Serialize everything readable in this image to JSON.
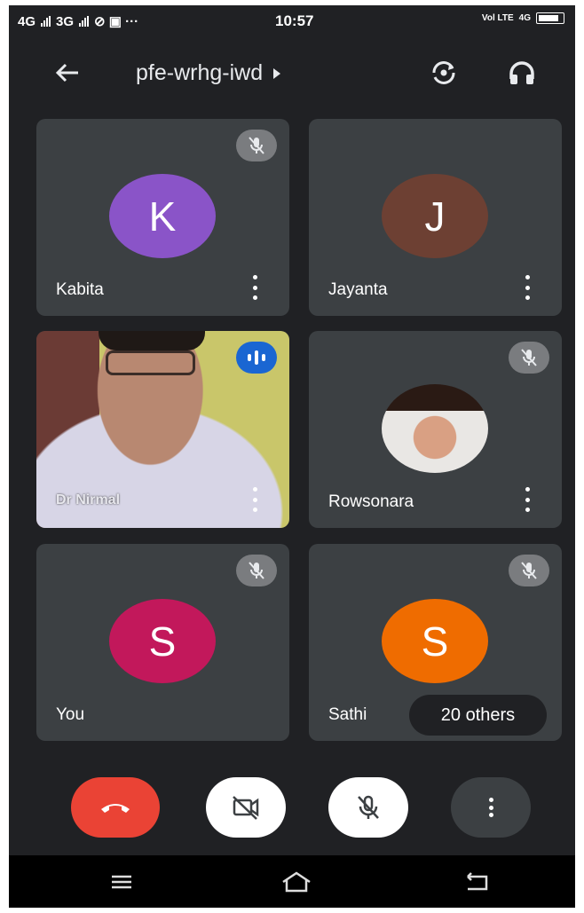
{
  "status_bar": {
    "network1": "4G",
    "network2": "3G",
    "time": "10:57",
    "carrier": "Vol LTE",
    "lte": "4G"
  },
  "app_bar": {
    "meeting_code": "pfe-wrhg-iwd"
  },
  "participants": [
    {
      "name": "Kabita",
      "initial": "K",
      "color": "#8a54c8",
      "muted": true
    },
    {
      "name": "Jayanta",
      "initial": "J",
      "color": "#6d4033",
      "muted": false
    },
    {
      "name": "Dr Nirmal",
      "speaking": true,
      "video": true
    },
    {
      "name": "Rowsonara",
      "photo": true,
      "muted": true
    },
    {
      "name": "You",
      "initial": "S",
      "color": "#c2185b",
      "muted": true
    },
    {
      "name": "Sathi",
      "initial": "S",
      "color": "#ef6c00",
      "muted": true
    }
  ],
  "others_chip": "20 others",
  "controls": {
    "icons": [
      "end-call-icon",
      "camera-off-icon",
      "mic-off-icon",
      "more-vert-icon"
    ]
  },
  "colors": {
    "background": "#202124",
    "tile": "#3c4043",
    "end_call": "#ea4335",
    "speaking": "#1a66d2"
  }
}
